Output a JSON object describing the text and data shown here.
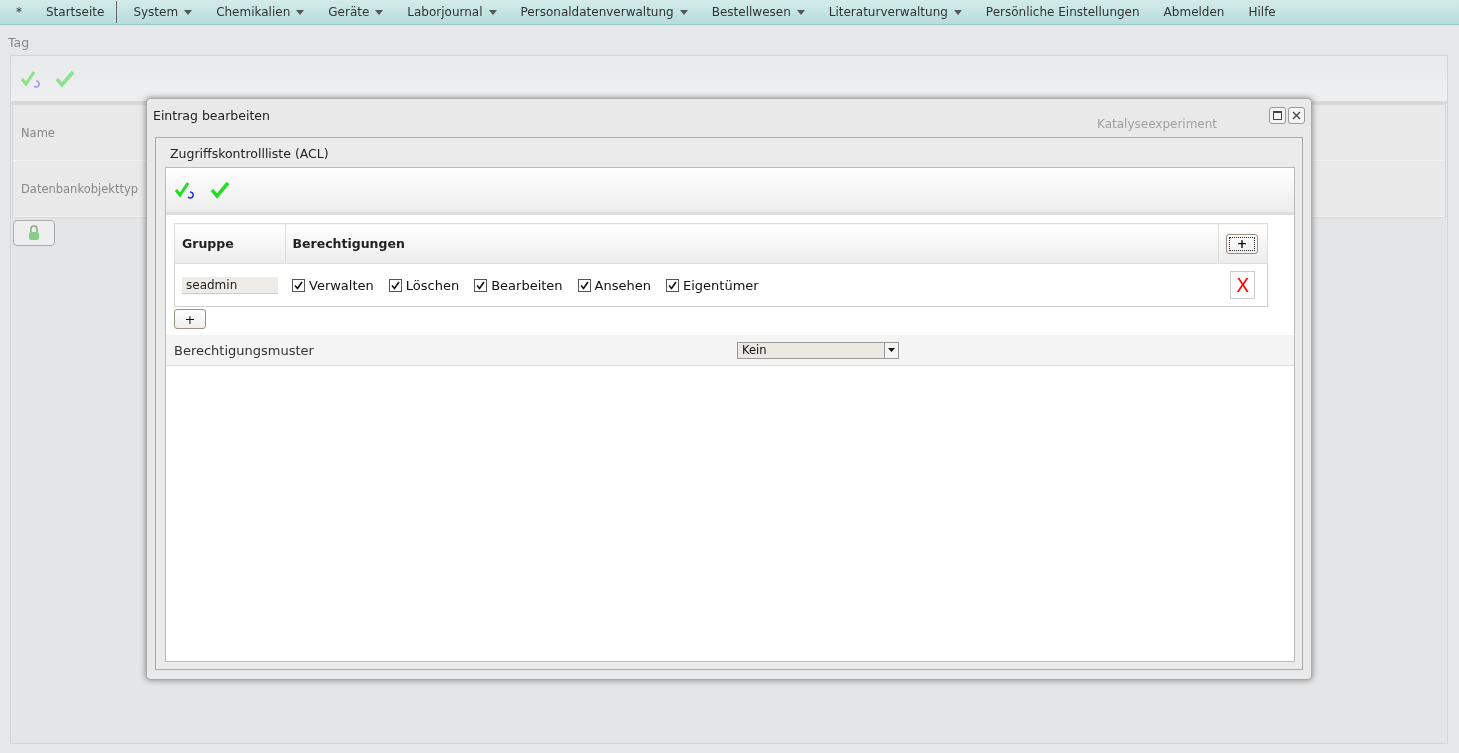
{
  "menu": [
    {
      "label": "*",
      "dropdown": false
    },
    {
      "label": "Startseite",
      "dropdown": false
    },
    {
      "label": "System",
      "dropdown": true
    },
    {
      "label": "Chemikalien",
      "dropdown": true
    },
    {
      "label": "Geräte",
      "dropdown": true
    },
    {
      "label": "Laborjournal",
      "dropdown": true
    },
    {
      "label": "Personaldatenverwaltung",
      "dropdown": true
    },
    {
      "label": "Bestellwesen",
      "dropdown": true
    },
    {
      "label": "Literaturverwaltung",
      "dropdown": true
    },
    {
      "label": "Persönliche Einstellungen",
      "dropdown": false
    },
    {
      "label": "Abmelden",
      "dropdown": false
    },
    {
      "label": "Hilfe",
      "dropdown": false
    }
  ],
  "page": {
    "title": "Tag",
    "fields": [
      {
        "label": "Name"
      },
      {
        "label": "Datenbankobjekttyp"
      }
    ],
    "background_value": "Katalyseexperiment"
  },
  "dialog": {
    "title": "Eintrag bearbeiten",
    "section": "Zugriffskontrollliste (ACL)",
    "columns": [
      "Gruppe",
      "Berechtigungen"
    ],
    "add_header": "+",
    "rows": [
      {
        "group": "seadmin",
        "delete": "X",
        "permissions": [
          {
            "label": "Verwalten",
            "checked": true
          },
          {
            "label": "Löschen",
            "checked": true
          },
          {
            "label": "Bearbeiten",
            "checked": true
          },
          {
            "label": "Ansehen",
            "checked": true
          },
          {
            "label": "Eigentümer",
            "checked": true
          }
        ]
      }
    ],
    "add_row": "+",
    "pattern": {
      "label": "Berechtigungsmuster",
      "value": "Kein"
    }
  }
}
